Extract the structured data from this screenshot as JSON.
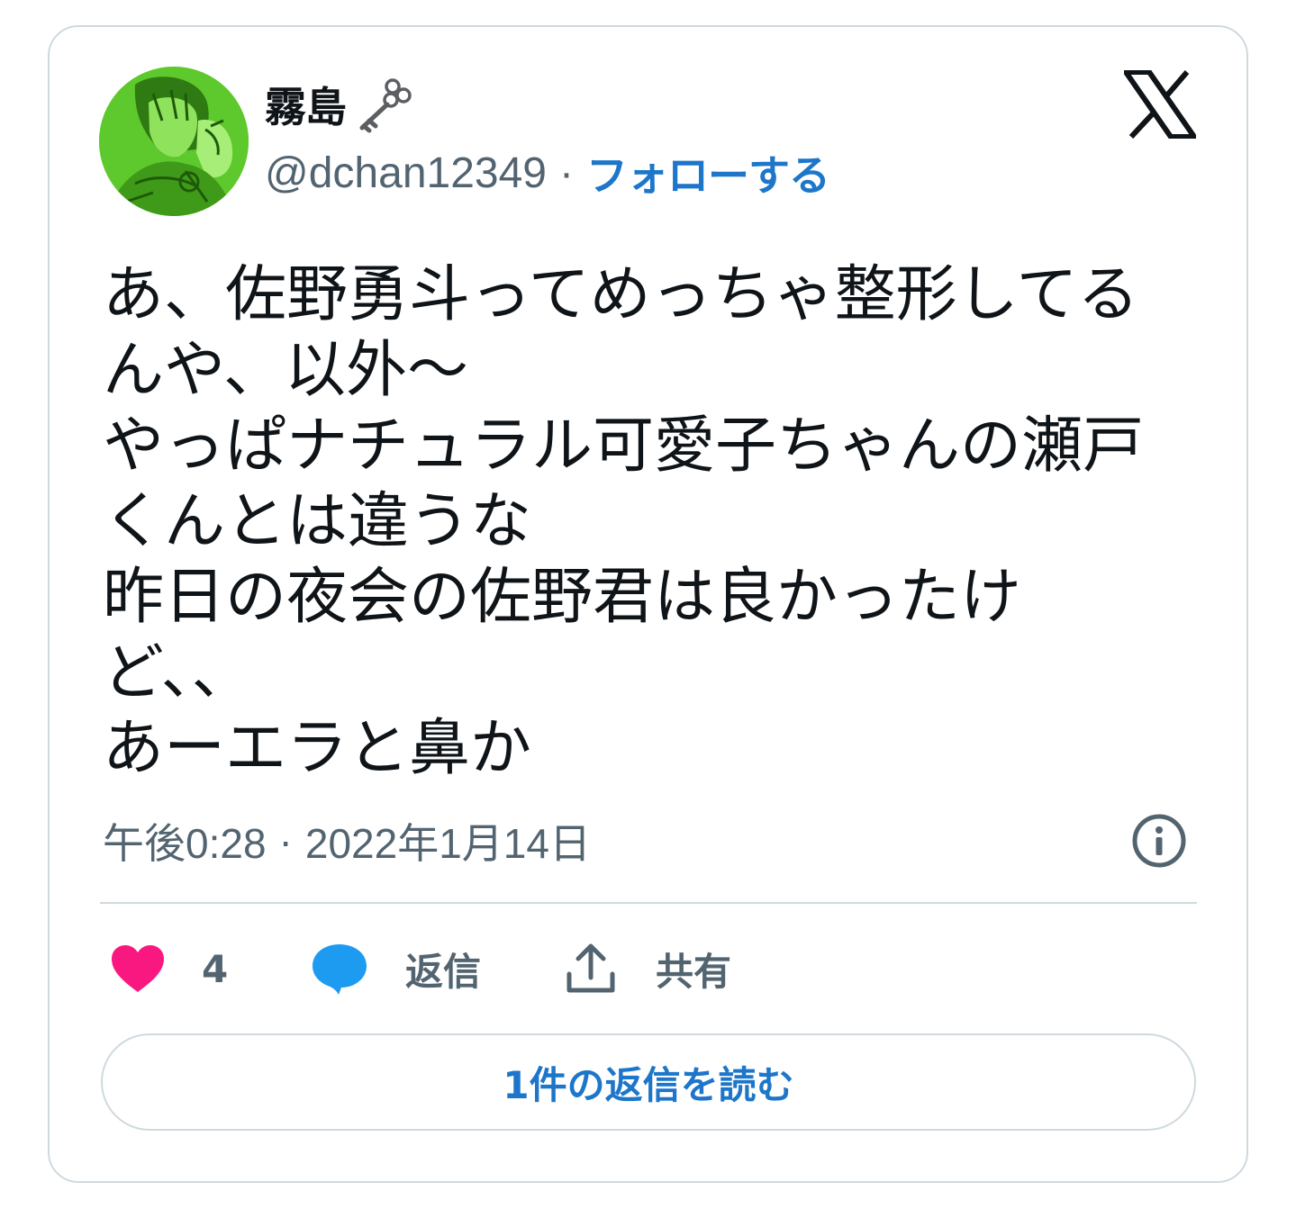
{
  "tweet": {
    "display_name": "霧島",
    "name_emoji": "old-key-icon",
    "handle": "@dchan12349",
    "separator": "·",
    "follow_label": "フォローする",
    "avatar": "green-illustrated-avatar",
    "brand_icon": "x-logo-icon",
    "text": "あ、佐野勇斗ってめっちゃ整形してる\nんや、以外〜\nやっぱナチュラル可愛子ちゃんの瀬戸\nくんとは違うな\n昨日の夜会の佐野君は良かったけ\nど、、\nあーエラと鼻か",
    "time": "午後0:28",
    "date": "2022年1月14日",
    "info_icon": "info-icon"
  },
  "actions": {
    "like_count": "4",
    "reply_label": "返信",
    "share_label": "共有"
  },
  "read_replies_label": "1件の返信を読む",
  "colors": {
    "link_blue": "#1d76c9",
    "secondary_text": "#536471",
    "primary_text": "#0f1419",
    "heart_pink": "#f91880",
    "reply_blue": "#1d9bf0",
    "border": "#cfd9de"
  }
}
